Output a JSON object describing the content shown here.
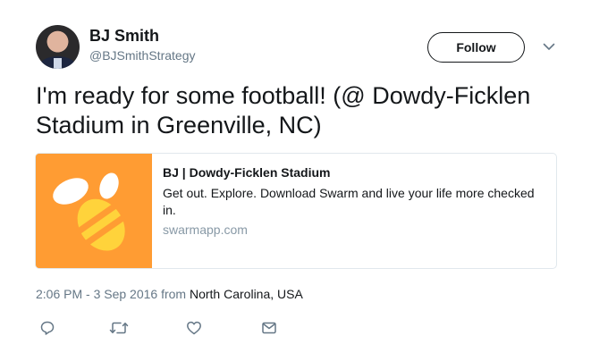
{
  "user": {
    "name": "BJ Smith",
    "handle": "@BJSmithStrategy"
  },
  "follow": {
    "label": "Follow"
  },
  "tweet": {
    "text": "I'm ready for some football! (@ Dowdy-Ficklen Stadium in Greenville, NC)"
  },
  "card": {
    "title": "BJ | Dowdy-Ficklen Stadium",
    "description": "Get out. Explore. Download Swarm and live your life more checked in.",
    "domain": "swarmapp.com",
    "brand_color": "#ff9c33"
  },
  "meta": {
    "timestamp": "2:06 PM - 3 Sep 2016",
    "from": " from ",
    "location": "North Carolina, USA"
  },
  "actions": [
    "reply-icon",
    "retweet-icon",
    "like-icon",
    "message-icon"
  ],
  "colors": {
    "text": "#14171a",
    "secondary": "#657786",
    "icon": "#657786"
  }
}
